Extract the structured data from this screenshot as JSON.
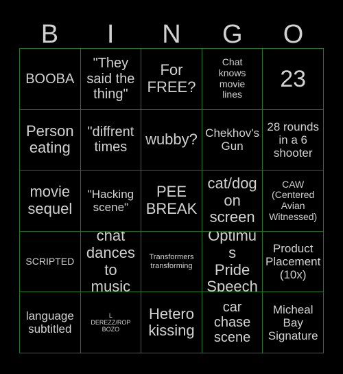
{
  "card": {
    "title": "BINGO",
    "background_color": "#000000",
    "grid_line_color": "#1f7a1f",
    "text_color": "#d2d2d2",
    "header_letters": [
      "B",
      "I",
      "N",
      "G",
      "O"
    ],
    "columns": 5,
    "rows": 5,
    "cells": [
      [
        {
          "text": "BOOBA",
          "size": "lg"
        },
        {
          "text": "\"They\nsaid the\nthing\"",
          "size": "lg"
        },
        {
          "text": "For\nFREE?",
          "size": "xl"
        },
        {
          "text": "Chat\nknows\nmovie\nlines",
          "size": "sm"
        },
        {
          "text": "23",
          "size": "xxl"
        }
      ],
      [
        {
          "text": "Person\neating",
          "size": "xl"
        },
        {
          "text": "\"diffrent\ntimes",
          "size": "lg"
        },
        {
          "text": "wubby?",
          "size": "xl"
        },
        {
          "text": "Chekhov's\nGun",
          "size": "md"
        },
        {
          "text": "28 rounds\nin a 6\nshooter",
          "size": "md"
        }
      ],
      [
        {
          "text": "movie\nsequel",
          "size": "xl"
        },
        {
          "text": "\"Hacking\nscene\"",
          "size": "md"
        },
        {
          "text": "PEE\nBREAK",
          "size": "xl"
        },
        {
          "text": "cat/dog\non\nscreen",
          "size": "xl"
        },
        {
          "text": "CAW\n(Centered\nAvian\nWitnessed)",
          "size": "sm"
        }
      ],
      [
        {
          "text": "SCRIPTED",
          "size": "sm"
        },
        {
          "text": "chat\ndances\nto music",
          "size": "xl"
        },
        {
          "text": "Transformers\ntransforming",
          "size": "xs"
        },
        {
          "text": "Optimus\nPride\nSpeech",
          "size": "xl"
        },
        {
          "text": "Product\nPlacement\n(10x)",
          "size": "md"
        }
      ],
      [
        {
          "text": "language\nsubtitled",
          "size": "md"
        },
        {
          "text": "L\nDEREZZ/ROP\nBOZO",
          "size": "xxs"
        },
        {
          "text": "Hetero\nkissing",
          "size": "xl"
        },
        {
          "text": "car\nchase\nscene",
          "size": "lg"
        },
        {
          "text": "Micheal\nBay\nSignature",
          "size": "md"
        }
      ]
    ]
  }
}
